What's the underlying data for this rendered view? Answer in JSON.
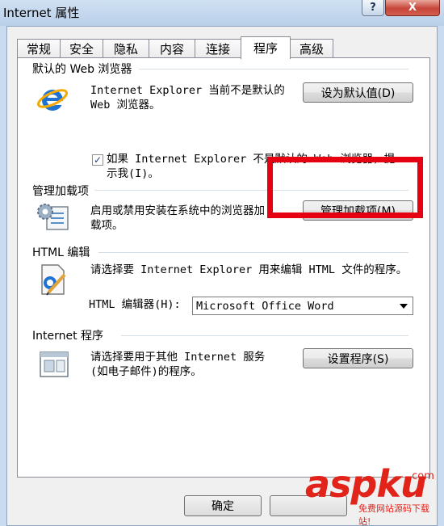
{
  "window": {
    "title": "Internet 属性",
    "help_label": "?",
    "close_label": "X"
  },
  "tabs": [
    {
      "label": "常规",
      "active": false
    },
    {
      "label": "安全",
      "active": false
    },
    {
      "label": "隐私",
      "active": false
    },
    {
      "label": "内容",
      "active": false
    },
    {
      "label": "连接",
      "active": false
    },
    {
      "label": "程序",
      "active": true
    },
    {
      "label": "高级",
      "active": false
    }
  ],
  "default_browser": {
    "title": "默认的 Web 浏览器",
    "text_line1": "Internet Explorer 当前不是默认的",
    "text_line2": "Web 浏览器。",
    "button_label": "设为默认值(D)",
    "checkbox_checked": true,
    "checkbox_mark": "✓",
    "checkbox_line1": "如果 Internet Explorer 不是默认的 Web 浏览器，提",
    "checkbox_line2": "示我(I)。"
  },
  "addons": {
    "title": "管理加载项",
    "text_line1": "启用或禁用安装在系统中的浏览器加",
    "text_line2": "载项。",
    "button_label": "管理加载项(M)"
  },
  "html_editing": {
    "title": "HTML 编辑",
    "text": "请选择要 Internet Explorer 用来编辑 HTML 文件的程序。",
    "editor_label": "HTML 编辑器(H):",
    "editor_value": "Microsoft Office Word"
  },
  "internet_programs": {
    "title": "Internet 程序",
    "text_line1": "请选择要用于其他 Internet 服务",
    "text_line2": "(如电子邮件)的程序。",
    "button_label": "设置程序(S)"
  },
  "footer": {
    "ok_label": "确定"
  },
  "watermark": {
    "brand": "aspku",
    "domain": ".com",
    "slogan": "免费网站源码下载站!"
  },
  "colors": {
    "highlight": "#e60012",
    "ie_blue": "#1e73d2",
    "ie_ring": "#f2a900"
  }
}
